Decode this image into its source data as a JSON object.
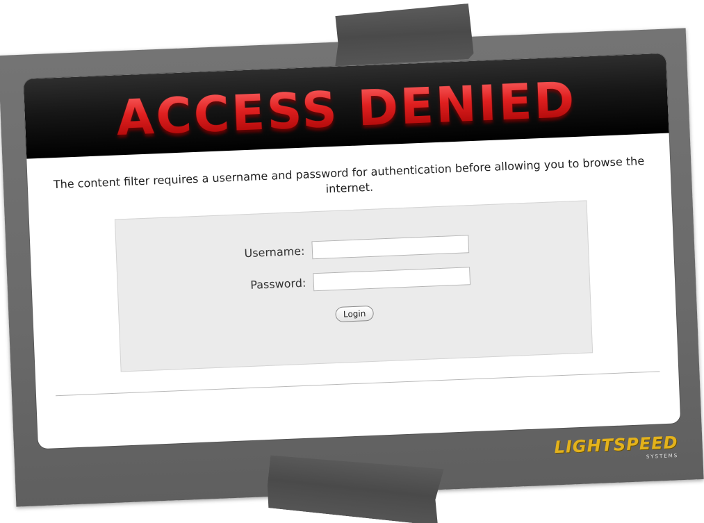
{
  "banner": {
    "title": "ACCESS DENIED"
  },
  "message": "The content filter requires a username and password for authentication before allowing you to browse the internet.",
  "login_form": {
    "username_label": "Username:",
    "username_value": "",
    "password_label": "Password:",
    "password_value": "",
    "submit_label": "Login"
  },
  "logo": {
    "name": "LIGHTSPEED",
    "subtitle": "SYSTEMS"
  },
  "colors": {
    "banner_bg": "#000000",
    "title_red": "#d01818",
    "board_gray": "#6a6a6a",
    "logo_gold": "#e3b21c"
  }
}
